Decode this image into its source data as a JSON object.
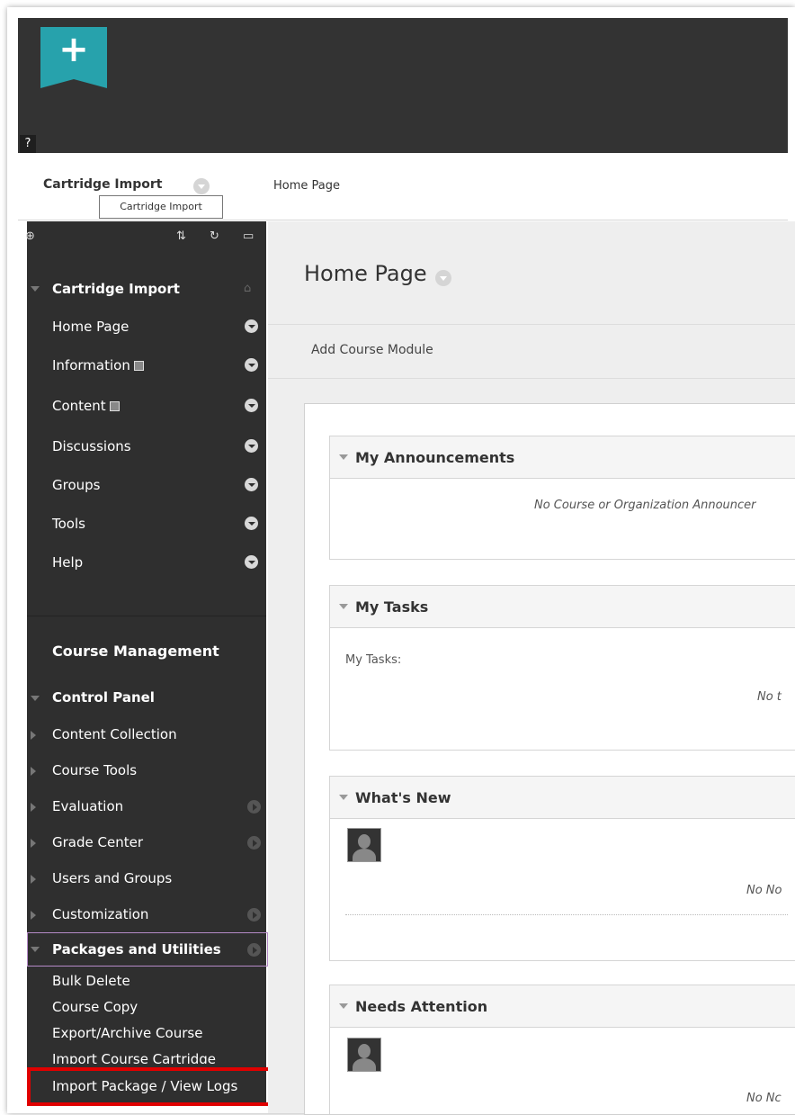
{
  "header": {
    "logo_glyph": "+",
    "help_glyph": "?"
  },
  "breadcrumb": {
    "course": "Cartridge Import",
    "page": "Home Page",
    "tooltip": "Cartridge Import"
  },
  "sidebar": {
    "tools": [
      "⊕",
      "⇅",
      "↻",
      "▭"
    ],
    "course_title": "Cartridge Import",
    "items": [
      {
        "label": "Home Page"
      },
      {
        "label": "Information"
      },
      {
        "label": "Content"
      },
      {
        "label": "Discussions"
      },
      {
        "label": "Groups"
      },
      {
        "label": "Tools"
      },
      {
        "label": "Help"
      }
    ],
    "course_management": "Course Management",
    "control_panel": "Control Panel",
    "cp_items": [
      {
        "label": "Content Collection"
      },
      {
        "label": "Course Tools"
      },
      {
        "label": "Evaluation"
      },
      {
        "label": "Grade Center"
      },
      {
        "label": "Users and Groups"
      },
      {
        "label": "Customization"
      }
    ],
    "packages": "Packages and Utilities",
    "pkg_items": [
      {
        "label": "Bulk Delete"
      },
      {
        "label": "Course Copy"
      },
      {
        "label": "Export/Archive Course"
      },
      {
        "label": "Import Course Cartridge"
      },
      {
        "label": "Import Package / View Logs"
      }
    ]
  },
  "main": {
    "title": "Home Page",
    "add_module": "Add Course Module",
    "modules": {
      "announcements": {
        "title": "My Announcements",
        "message": "No Course or Organization Announcer"
      },
      "tasks": {
        "title": "My Tasks",
        "label": "My Tasks:",
        "message": "No t"
      },
      "whats_new": {
        "title": "What's New",
        "message": "No No"
      },
      "needs_attention": {
        "title": "Needs Attention",
        "message": "No Nc"
      }
    }
  },
  "colors": {
    "topbar": "#333333",
    "logo": "#27a2ac",
    "sidebar": "#2f2f2f",
    "highlight": "#e00000"
  }
}
